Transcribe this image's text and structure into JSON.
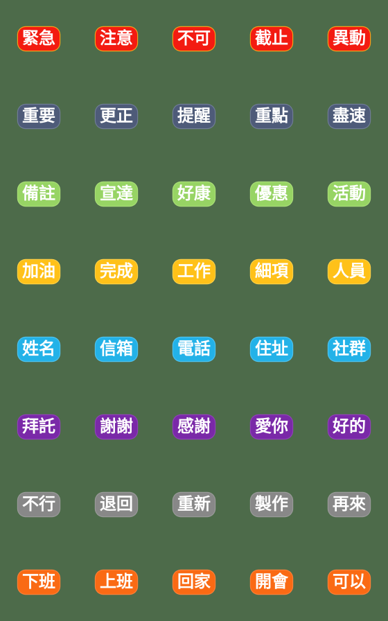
{
  "sheet": {
    "background_color": "#4d6b4a",
    "columns": 5,
    "rows": 8,
    "text_color": "#ffffff"
  },
  "rows": [
    {
      "row_index": 1,
      "theme": "red",
      "color": "#f31b11",
      "outline_color": "#f5a01a",
      "stickers": [
        {
          "label": "緊急"
        },
        {
          "label": "注意"
        },
        {
          "label": "不可"
        },
        {
          "label": "截止"
        },
        {
          "label": "異動"
        }
      ]
    },
    {
      "row_index": 2,
      "theme": "slate",
      "color": "#4e5b79",
      "outline_color": "#6f7c96",
      "stickers": [
        {
          "label": "重要"
        },
        {
          "label": "更正"
        },
        {
          "label": "提醒"
        },
        {
          "label": "重點"
        },
        {
          "label": "盡速"
        }
      ]
    },
    {
      "row_index": 3,
      "theme": "green",
      "color": "#97d464",
      "outline_color": "#a9de77",
      "stickers": [
        {
          "label": "備註"
        },
        {
          "label": "宣達"
        },
        {
          "label": "好康"
        },
        {
          "label": "優惠"
        },
        {
          "label": "活動"
        }
      ]
    },
    {
      "row_index": 4,
      "theme": "amber",
      "color": "#ffc119",
      "outline_color": "#ffcf45",
      "stickers": [
        {
          "label": "加油"
        },
        {
          "label": "完成"
        },
        {
          "label": "工作"
        },
        {
          "label": "細項"
        },
        {
          "label": "人員"
        }
      ]
    },
    {
      "row_index": 5,
      "theme": "sky",
      "color": "#23b2e8",
      "outline_color": "#4ec2ee",
      "stickers": [
        {
          "label": "姓名"
        },
        {
          "label": "信箱"
        },
        {
          "label": "電話"
        },
        {
          "label": "住址"
        },
        {
          "label": "社群"
        }
      ]
    },
    {
      "row_index": 6,
      "theme": "purple",
      "color": "#7a29a8",
      "outline_color": "#8f41b8",
      "stickers": [
        {
          "label": "拜託"
        },
        {
          "label": "謝謝"
        },
        {
          "label": "感謝"
        },
        {
          "label": "愛你"
        },
        {
          "label": "好的"
        }
      ]
    },
    {
      "row_index": 7,
      "theme": "gray",
      "color": "#888888",
      "outline_color": "#9a9a9a",
      "stickers": [
        {
          "label": "不行"
        },
        {
          "label": "退回"
        },
        {
          "label": "重新"
        },
        {
          "label": "製作"
        },
        {
          "label": "再來"
        }
      ]
    },
    {
      "row_index": 8,
      "theme": "orange",
      "color": "#fa6a14",
      "outline_color": "#fb8038",
      "stickers": [
        {
          "label": "下班"
        },
        {
          "label": "上班"
        },
        {
          "label": "回家"
        },
        {
          "label": "開會"
        },
        {
          "label": "可以"
        }
      ]
    }
  ]
}
